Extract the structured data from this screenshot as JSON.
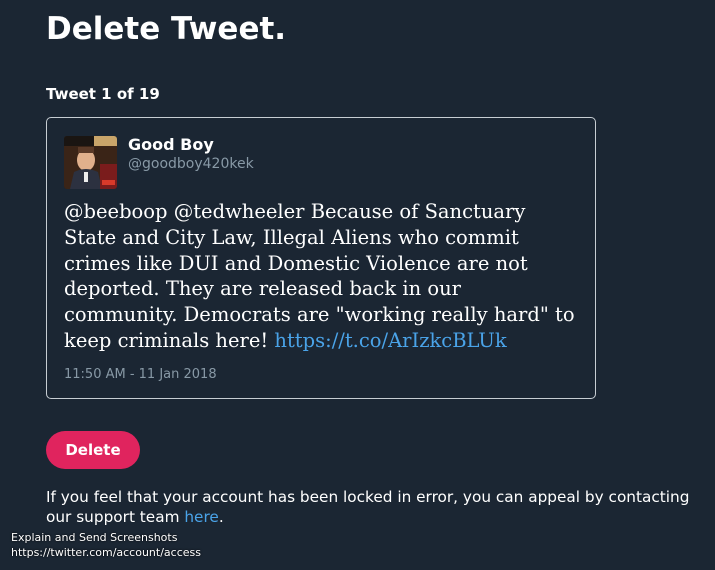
{
  "page": {
    "title": "Delete Tweet."
  },
  "counter": {
    "text": "Tweet 1 of 19"
  },
  "tweet": {
    "author_name": "Good Boy",
    "author_handle": "@goodboy420kek",
    "avatar_icon": "profile-photo",
    "text": "@beeboop @tedwheeler Because of Sanctuary State and City Law, Illegal Aliens who commit crimes like DUI and Domestic Violence are not deported. They are released back in our community. Democrats are \"working really hard\" to keep criminals here! ",
    "link_text": "https://t.co/ArIzkcBLUk",
    "timestamp": "11:50 AM - 11 Jan 2018"
  },
  "actions": {
    "delete_label": "Delete"
  },
  "appeal": {
    "text": "If you feel that your account has been locked in error, you can appeal by contacting our support team ",
    "link_text": "here",
    "suffix": "."
  },
  "status_popup": {
    "title": "Explain and Send Screenshots",
    "url": "https://twitter.com/account/access"
  },
  "colors": {
    "background": "#1b2633",
    "accent_link": "#4aa3e8",
    "delete_button": "#e0245e",
    "muted_text": "#8899a6"
  }
}
